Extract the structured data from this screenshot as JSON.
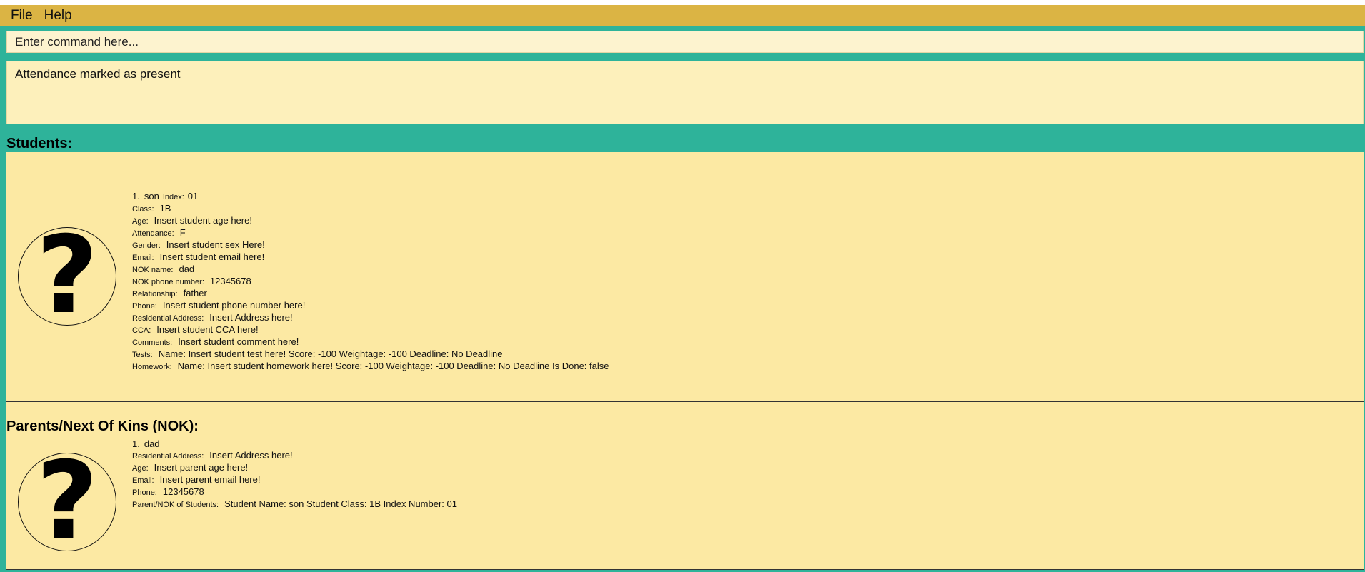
{
  "menu": {
    "file": "File",
    "help": "Help"
  },
  "command": {
    "placeholder": "Enter command here..."
  },
  "result": {
    "text": "Attendance marked as present"
  },
  "students_title": "Students:",
  "nok_title": "Parents/Next Of Kins (NOK):",
  "avatar_glyph": "?",
  "student": {
    "number": "1.",
    "name": "son",
    "index_label": "Index:",
    "index": "01",
    "fields": [
      {
        "label": "Class:",
        "value": "1B"
      },
      {
        "label": "Age:",
        "value": "Insert student age here!"
      },
      {
        "label": "Attendance:",
        "value": "F"
      },
      {
        "label": "Gender:",
        "value": "Insert student sex Here!"
      },
      {
        "label": "Email:",
        "value": "Insert student email here!"
      },
      {
        "label": "NOK name:",
        "value": "dad"
      },
      {
        "label": "NOK phone number:",
        "value": "12345678"
      },
      {
        "label": "Relationship:",
        "value": "father"
      },
      {
        "label": "Phone:",
        "value": "Insert student phone number here!"
      },
      {
        "label": "Residential Address:",
        "value": "Insert Address here!"
      },
      {
        "label": "CCA:",
        "value": "Insert student CCA here!"
      },
      {
        "label": "Comments:",
        "value": "Insert student comment here!"
      },
      {
        "label": "Tests:",
        "value": "Name: Insert student test here! Score: -100 Weightage: -100 Deadline: No Deadline"
      },
      {
        "label": "Homework:",
        "value": "Name: Insert student homework here! Score: -100 Weightage: -100 Deadline: No Deadline Is Done: false"
      }
    ]
  },
  "nok": {
    "number": "1.",
    "name": "dad",
    "fields": [
      {
        "label": "Residential Address:",
        "value": "Insert Address here!"
      },
      {
        "label": "Age:",
        "value": "Insert parent age here!"
      },
      {
        "label": "Email:",
        "value": "Insert parent email here!"
      },
      {
        "label": "Phone:",
        "value": "12345678"
      },
      {
        "label": "Parent/NOK of Students:",
        "value": "Student Name: son Student Class: 1B Index Number: 01"
      }
    ]
  }
}
